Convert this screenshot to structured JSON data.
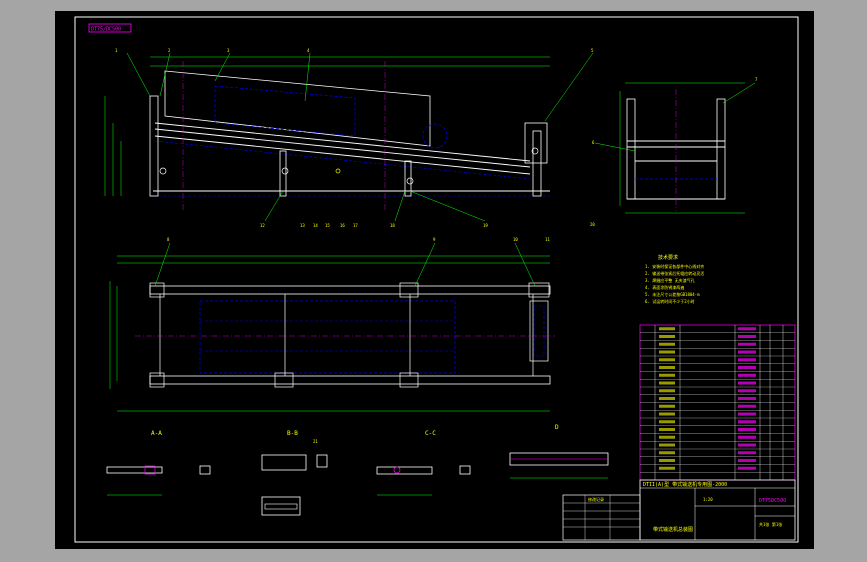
{
  "colors": {
    "background": "#a5a5a5",
    "sheet": "#000000",
    "frame": "#ffffff",
    "outline": "#ffffff",
    "dimension": "#00ff00",
    "hidden": "#0000ff",
    "center": "#ff00ff",
    "text": "#ffff00",
    "table_line": "#ff00ff"
  },
  "drawing": {
    "stamp": "DT75/DC500",
    "section_labels": [
      "A-A",
      "B-B",
      "C-C",
      "D"
    ],
    "balloons": [
      "1",
      "2",
      "3",
      "4",
      "5",
      "6",
      "7",
      "8",
      "9",
      "10",
      "11",
      "12",
      "13",
      "14",
      "15",
      "16",
      "17",
      "18",
      "19",
      "20",
      "21"
    ],
    "notes_title": "技术要求",
    "notes": [
      "1. 安装时保证各部件中心线对齐",
      "2. 输送带张紧后托辊应转动灵活",
      "3. 焊缝应平整 无夹渣气孔",
      "4. 表面涂防锈漆两遍",
      "5. 未注尺寸公差按GB1804-m",
      "6. 试运转时间不少于2小时"
    ],
    "title_block": {
      "title": "DTII(A)型 带式输送机专用图-2000",
      "drawing_name": "带式输送机总装图",
      "drawing_no": "DT75DC500",
      "scale": "1:20",
      "sheet": "共1张 第1张"
    },
    "revision_title": "修改记录"
  }
}
